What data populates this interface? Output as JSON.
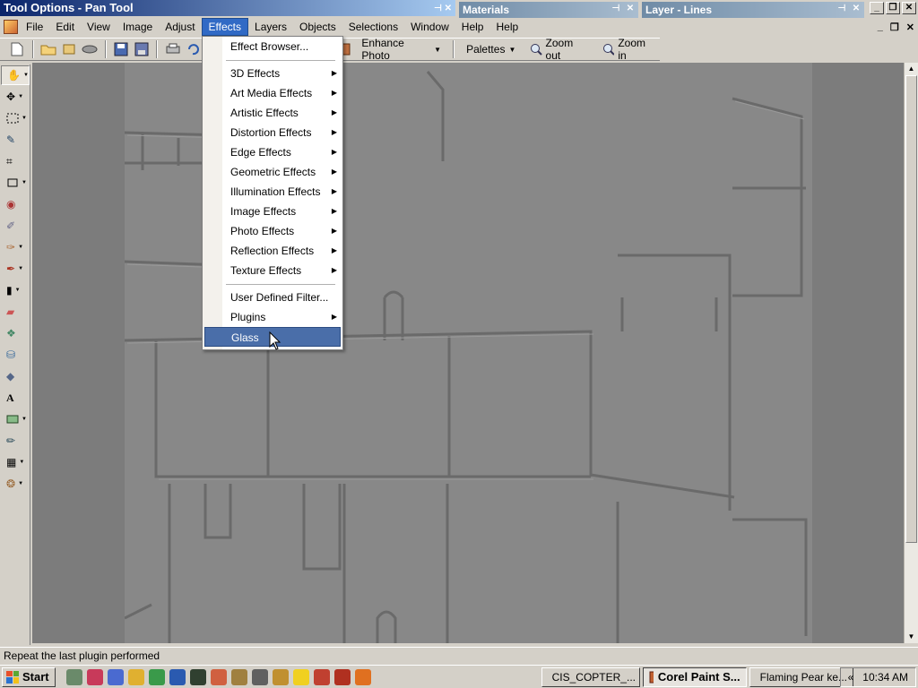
{
  "window": {
    "title": "Tool Options - Pan Tool",
    "palettes": [
      {
        "title": "Materials"
      },
      {
        "title": "Layer - Lines"
      }
    ]
  },
  "menubar": {
    "items": [
      "File",
      "Edit",
      "View",
      "Image",
      "Adjust",
      "Effects",
      "Layers",
      "Objects",
      "Selections",
      "Window",
      "Help",
      "Help"
    ],
    "active": "Effects"
  },
  "toolbar": {
    "enhance_photo": "Enhance Photo",
    "palettes": "Palettes",
    "zoom_out": "Zoom out",
    "zoom_in": "Zoom in"
  },
  "effects_menu": {
    "top": "Effect Browser...",
    "groups": [
      "3D Effects",
      "Art Media Effects",
      "Artistic Effects",
      "Distortion Effects",
      "Edge Effects",
      "Geometric Effects",
      "Illumination Effects",
      "Image Effects",
      "Photo Effects",
      "Reflection Effects",
      "Texture Effects"
    ],
    "user_defined": "User Defined Filter...",
    "plugins": "Plugins",
    "highlighted": "Glass"
  },
  "statusbar": {
    "text": "Repeat the last plugin performed"
  },
  "taskbar": {
    "start": "Start",
    "tasks": [
      {
        "label": "CIS_COPTER_..."
      },
      {
        "label": "Corel Paint S..."
      },
      {
        "label": "Flaming Pear ke..."
      }
    ],
    "tray_arrow": "«",
    "clock": "10:34 AM"
  },
  "colors": {
    "title_gradient_start": "#0a246a",
    "menu_highlight": "#316ac5",
    "canvas": "#888888",
    "workspace": "#7c7c7c"
  }
}
